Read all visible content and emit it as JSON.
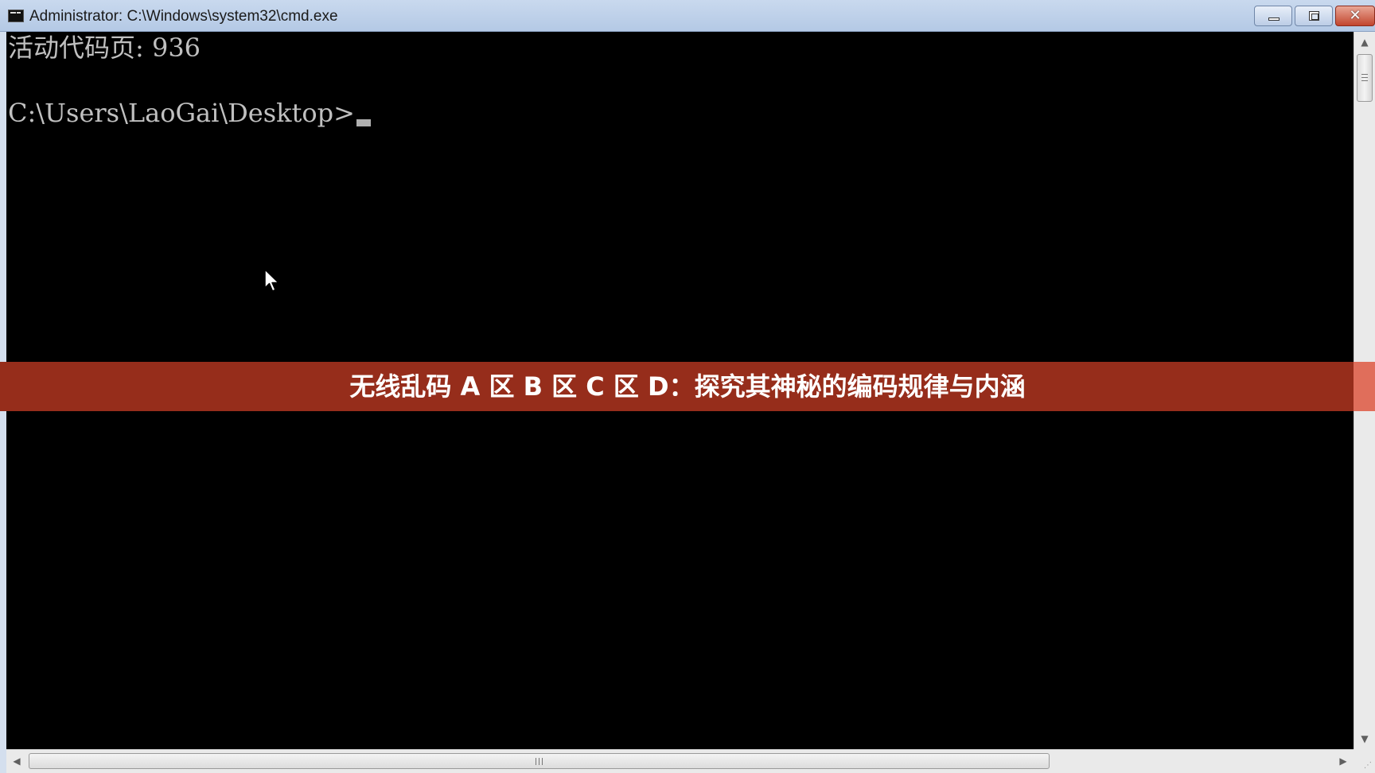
{
  "window": {
    "title": "Administrator: C:\\Windows\\system32\\cmd.exe",
    "close_glyph": "✕"
  },
  "console": {
    "lines": [
      "活动代码页: 936",
      "C:\\Users\\LaoGai\\Desktop>"
    ]
  },
  "banner": {
    "text": "无线乱码 A 区 B 区 C 区 D：探究其神秘的编码规律与内涵"
  },
  "scrollbars": {
    "up_arrow": "▲",
    "down_arrow": "▼",
    "left_arrow": "◀",
    "right_arrow": "▶"
  },
  "colors": {
    "console_bg": "#000000",
    "console_text": "#c0c0c0",
    "banner_bg": "#962d1b",
    "close_button": "#c2452e"
  }
}
